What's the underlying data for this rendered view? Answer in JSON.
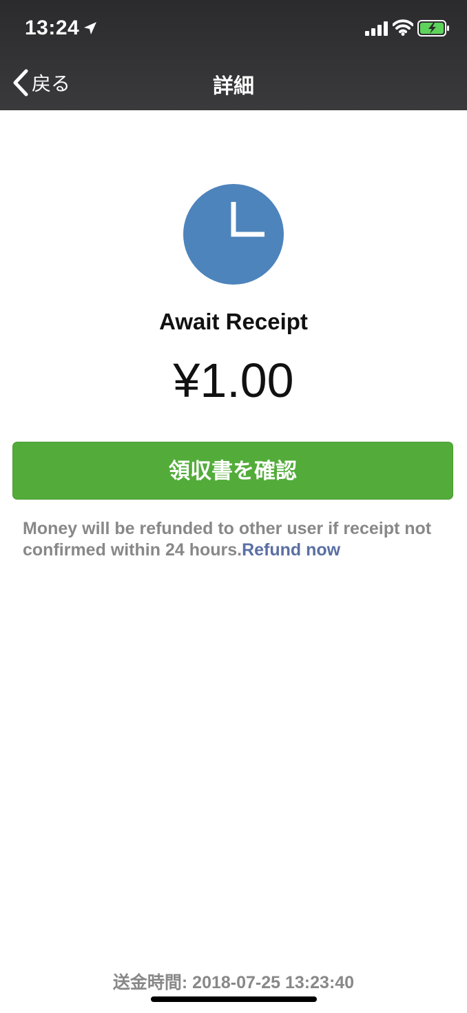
{
  "status_bar": {
    "time": "13:24"
  },
  "nav": {
    "back_label": "戻る",
    "title": "詳細"
  },
  "transfer": {
    "status_title": "Await Receipt",
    "amount": "¥1.00",
    "confirm_button_label": "領収書を確認",
    "note_text": "Money will be refunded to other user if receipt not confirmed within 24 hours.",
    "refund_link_label": "Refund now",
    "footer_time": "送金時間: 2018-07-25 13:23:40"
  },
  "icons": {
    "status_icon": "clock-icon",
    "back_icon": "chevron-left-icon"
  },
  "colors": {
    "accent_green": "#53ac3a",
    "clock_blue": "#4d84bc",
    "link_blue": "#5a6fa3",
    "battery_green": "#5ed35a"
  }
}
